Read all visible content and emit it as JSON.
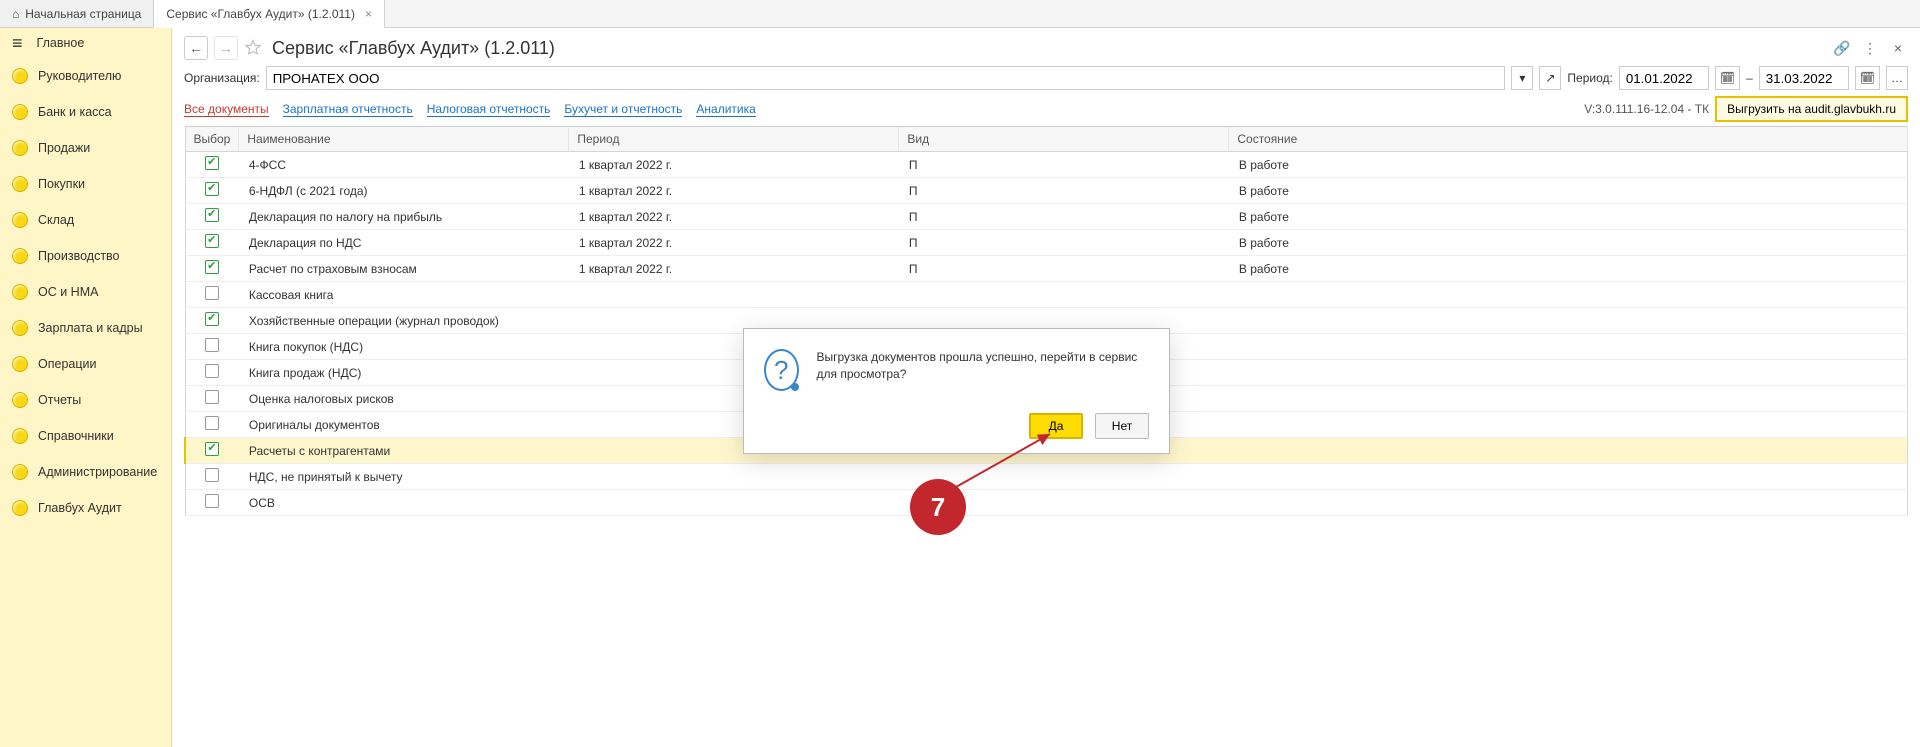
{
  "tabs": {
    "home": "Начальная страница",
    "active": "Сервис «Главбух Аудит» (1.2.011)"
  },
  "sidebar": {
    "main": "Главное",
    "items": [
      "Руководителю",
      "Банк и касса",
      "Продажи",
      "Покупки",
      "Склад",
      "Производство",
      "ОС и НМА",
      "Зарплата и кадры",
      "Операции",
      "Отчеты",
      "Справочники",
      "Администрирование",
      "Главбух Аудит"
    ]
  },
  "page": {
    "title": "Сервис «Главбух Аудит» (1.2.011)"
  },
  "org": {
    "label": "Организация:",
    "value": "ПРОНАТЕХ ООО",
    "period_label": "Период:",
    "from": "01.01.2022",
    "dash": "–",
    "to": "31.03.2022"
  },
  "filters": {
    "links": [
      "Все документы",
      "Зарплатная отчетность",
      "Налоговая отчетность",
      "Бухучет и отчетность",
      "Аналитика"
    ],
    "active_index": 0,
    "version": "V:3.0.111.16-12.04 - ТК",
    "upload": "Выгрузить на audit.glavbukh.ru"
  },
  "table": {
    "headers": [
      "Выбор",
      "Наименование",
      "Период",
      "Вид",
      "Состояние"
    ],
    "rows": [
      {
        "checked": true,
        "name": "4-ФСС",
        "period": "1 квартал 2022 г.",
        "kind": "П",
        "state": "В работе"
      },
      {
        "checked": true,
        "name": "6-НДФЛ (с 2021 года)",
        "period": "1 квартал 2022 г.",
        "kind": "П",
        "state": "В работе"
      },
      {
        "checked": true,
        "name": "Декларация по налогу на прибыль",
        "period": "1 квартал 2022 г.",
        "kind": "П",
        "state": "В работе"
      },
      {
        "checked": true,
        "name": "Декларация по НДС",
        "period": "1 квартал 2022 г.",
        "kind": "П",
        "state": "В работе"
      },
      {
        "checked": true,
        "name": "Расчет по страховым взносам",
        "period": "1 квартал 2022 г.",
        "kind": "П",
        "state": "В работе"
      },
      {
        "checked": false,
        "name": "Кассовая книга",
        "period": "",
        "kind": "",
        "state": ""
      },
      {
        "checked": true,
        "name": "Хозяйственные операции (журнал проводок)",
        "period": "",
        "kind": "",
        "state": ""
      },
      {
        "checked": false,
        "name": "Книга покупок (НДС)",
        "period": "",
        "kind": "",
        "state": ""
      },
      {
        "checked": false,
        "name": "Книга продаж (НДС)",
        "period": "",
        "kind": "",
        "state": ""
      },
      {
        "checked": false,
        "name": "Оценка налоговых рисков",
        "period": "",
        "kind": "",
        "state": ""
      },
      {
        "checked": false,
        "name": "Оригиналы документов",
        "period": "",
        "kind": "",
        "state": ""
      },
      {
        "checked": true,
        "selected": true,
        "name": "Расчеты с контрагентами",
        "period": "",
        "kind": "",
        "state": ""
      },
      {
        "checked": false,
        "name": "НДС, не принятый к вычету",
        "period": "",
        "kind": "",
        "state": ""
      },
      {
        "checked": false,
        "name": "ОСВ",
        "period": "",
        "kind": "",
        "state": ""
      }
    ]
  },
  "dialog": {
    "text": "Выгрузка документов прошла успешно, перейти в сервис для просмотра?",
    "yes": "Да",
    "no": "Нет"
  },
  "annotation": {
    "number": "7"
  }
}
